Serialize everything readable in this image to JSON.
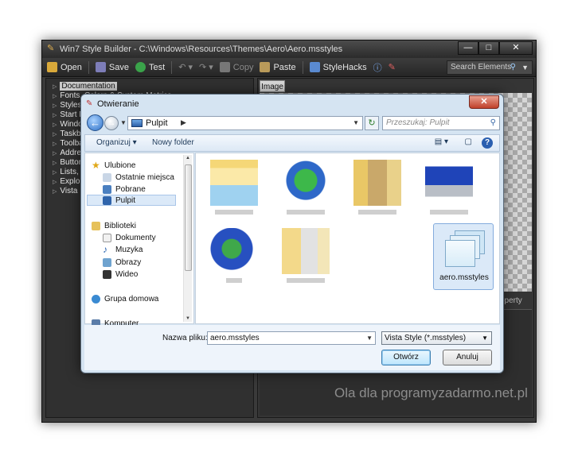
{
  "app": {
    "title": "Win7 Style Builder - C:\\Windows\\Resources\\Themes\\Aero\\Aero.msstyles",
    "window_buttons": [
      "—",
      "□",
      "✕"
    ],
    "toolbar": {
      "open": "Open",
      "save": "Save",
      "test": "Test",
      "copy": "Copy",
      "paste": "Paste",
      "stylehacks": "StyleHacks",
      "search_placeholder": "Search Elements"
    },
    "tree": [
      {
        "label": "Documentation",
        "selected": true
      },
      {
        "label": "Fonts, Colors & System Metrics"
      },
      {
        "label": "Styles"
      },
      {
        "label": "Start M"
      },
      {
        "label": "Windo"
      },
      {
        "label": "Taskb"
      },
      {
        "label": "Toolba"
      },
      {
        "label": "Addres"
      },
      {
        "label": "Button"
      },
      {
        "label": "Lists, N"
      },
      {
        "label": "Explore"
      },
      {
        "label": "Vista L"
      }
    ],
    "image_tab": "Image",
    "property_header": "operty",
    "watermark": "Ola dla programyzadarmo.net.pl"
  },
  "dialog": {
    "title": "Otwieranie",
    "close_glyph": "✕",
    "address": "Pulpit",
    "search_placeholder": "Przeszukaj: Pulpit",
    "organize": "Organizuj",
    "new_folder": "Nowy folder",
    "help": "?",
    "nav": {
      "favorites": "Ulubione",
      "recent": "Ostatnie miejsca",
      "downloads": "Pobrane",
      "desktop": "Pulpit",
      "libraries": "Biblioteki",
      "documents": "Dokumenty",
      "music": "Muzyka",
      "pictures": "Obrazy",
      "videos": "Wideo",
      "homegroup": "Grupa domowa",
      "computer": "Komputer"
    },
    "selected_file": "aero.msstyles",
    "filename_label": "Nazwa pliku:",
    "filename_value": "aero.msstyles",
    "filetype": "Vista Style (*.msstyles)",
    "open_button": "Otwórz",
    "cancel_button": "Anuluj"
  },
  "colors": {
    "dialog_bg": "#d5e4f2",
    "selection": "#dbe9f8",
    "app_bg": "#3a3a3a",
    "close_red": "#c0402a"
  }
}
